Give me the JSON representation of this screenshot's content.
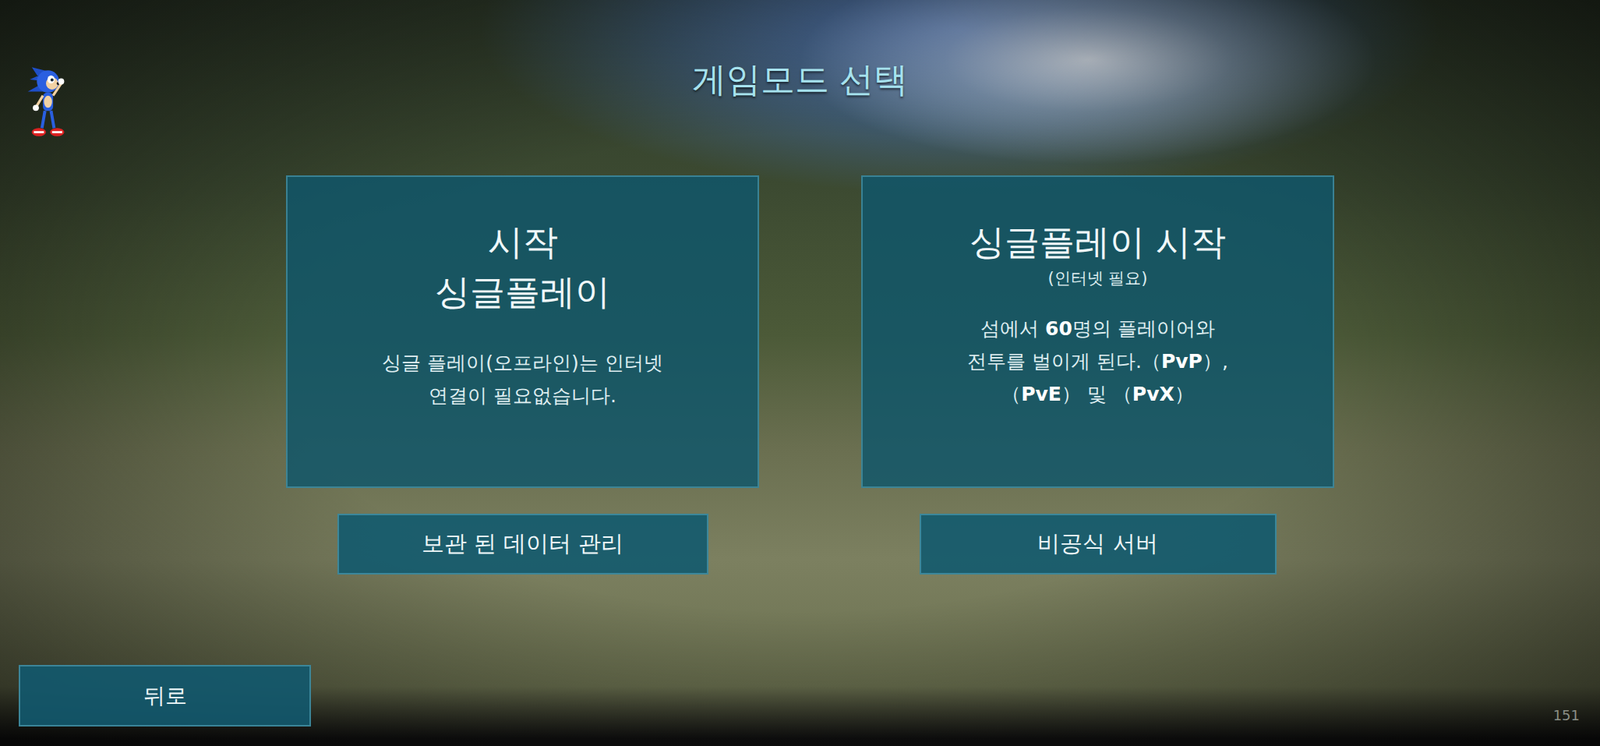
{
  "title": "게임모드 선택",
  "modes": [
    {
      "title_lines": [
        "시작",
        "싱글플레이"
      ],
      "note": "",
      "description": [
        [
          {
            "text": "싱글 플레이(오프라인)는 인터넷",
            "bold": false
          }
        ],
        [
          {
            "text": "연결이 필요없습니다.",
            "bold": false
          }
        ]
      ],
      "button": "보관 된 데이터 관리"
    },
    {
      "title_lines": [
        "싱글플레이 시작"
      ],
      "note": "(인터넷 필요)",
      "description": [
        [
          {
            "text": "섬에서 ",
            "bold": false
          },
          {
            "text": "60",
            "bold": true
          },
          {
            "text": "명의 플레이어와",
            "bold": false
          }
        ],
        [
          {
            "text": "전투를 벌이게 된다.（",
            "bold": false
          },
          {
            "text": "PvP",
            "bold": true
          },
          {
            "text": "）,",
            "bold": false
          }
        ],
        [
          {
            "text": "（",
            "bold": false
          },
          {
            "text": "PvE",
            "bold": true
          },
          {
            "text": "） 및 （",
            "bold": false
          },
          {
            "text": "PvX",
            "bold": true
          },
          {
            "text": "）",
            "bold": false
          }
        ]
      ],
      "button": "비공식 서버"
    }
  ],
  "back_button": "뒤로",
  "fps": "151"
}
